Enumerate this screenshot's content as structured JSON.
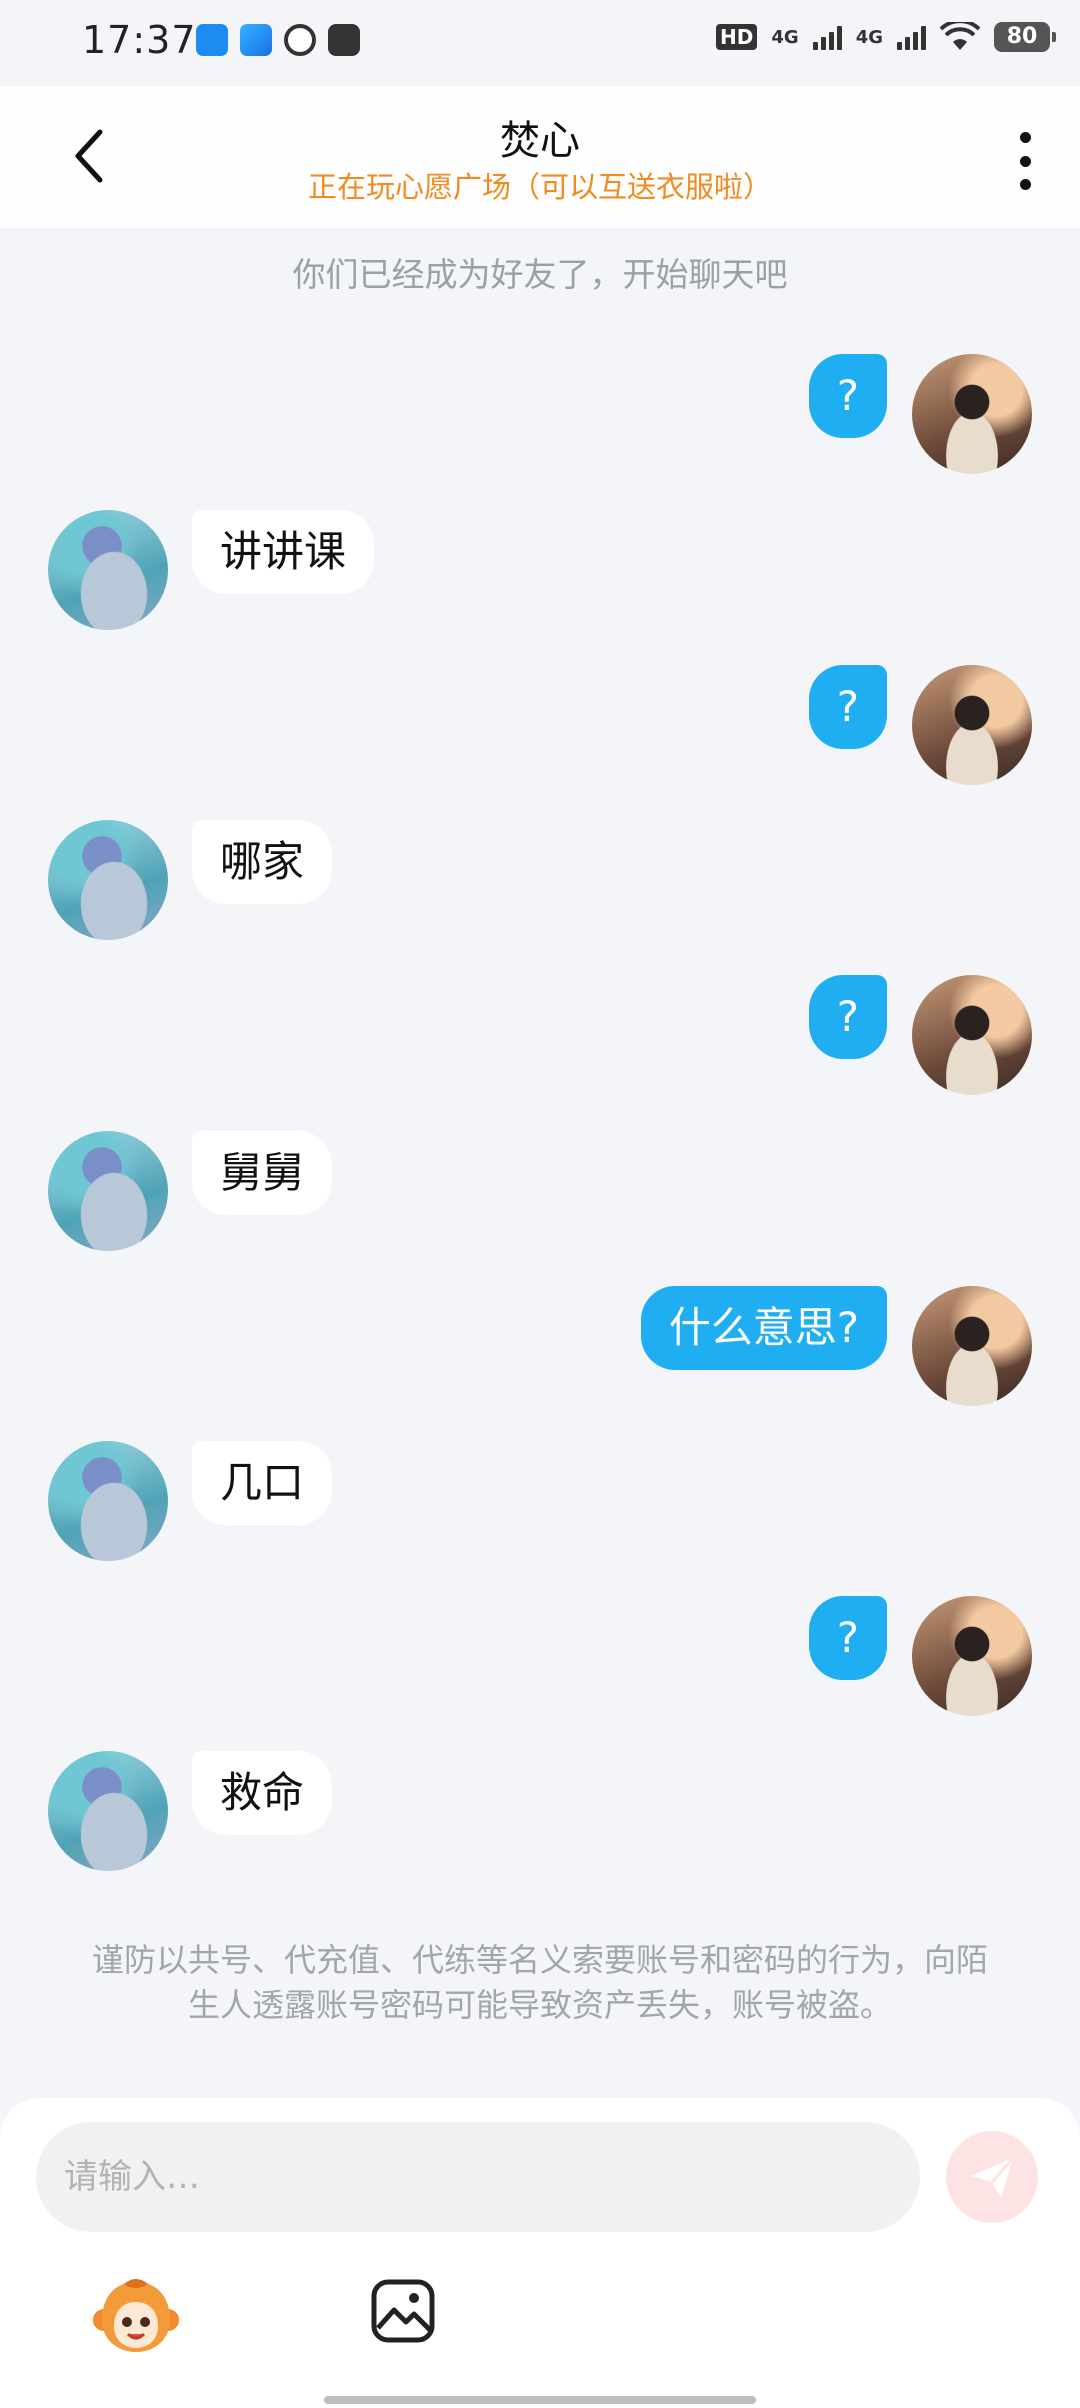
{
  "status_bar": {
    "time": "17:37",
    "hd_label": "HD",
    "network_1": "4G",
    "network_2": "4G",
    "battery": "80"
  },
  "header": {
    "title": "焚心",
    "subtitle": "正在玩心愿广场（可以互送衣服啦）"
  },
  "chat": {
    "system_note": "你们已经成为好友了，开始聊天吧",
    "messages": [
      {
        "side": "out",
        "text": "?"
      },
      {
        "side": "in",
        "text": "讲讲课"
      },
      {
        "side": "out",
        "text": "?"
      },
      {
        "side": "in",
        "text": "哪家"
      },
      {
        "side": "out",
        "text": "?"
      },
      {
        "side": "in",
        "text": "舅舅"
      },
      {
        "side": "out",
        "text": "什么意思?"
      },
      {
        "side": "in",
        "text": "几口"
      },
      {
        "side": "out",
        "text": "?"
      },
      {
        "side": "in",
        "text": "救命"
      }
    ],
    "warning": "谨防以共号、代充值、代练等名义索要账号和密码的行为，向陌生人透露账号密码可能导致资产丢失，账号被盗。"
  },
  "composer": {
    "placeholder": "请输入…"
  },
  "colors": {
    "accent_blue": "#20aef3",
    "subtitle_orange": "#f28a1e",
    "send_disabled": "#fde3e3"
  }
}
